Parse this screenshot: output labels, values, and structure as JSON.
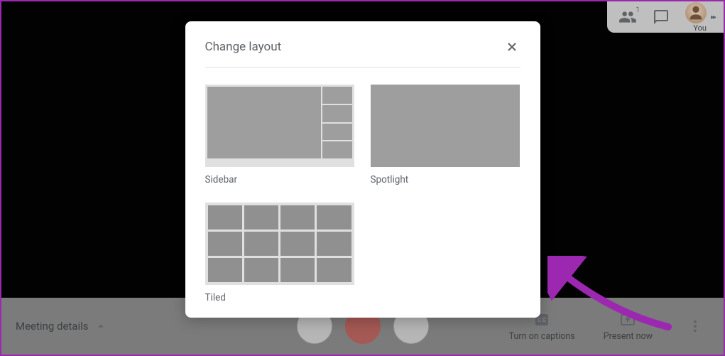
{
  "topbar": {
    "people_badge": "1",
    "profile_label": "You"
  },
  "dialog": {
    "title": "Change layout",
    "options": [
      {
        "label": "Sidebar"
      },
      {
        "label": "Spotlight"
      },
      {
        "label": "Tiled"
      }
    ]
  },
  "controls": {
    "meeting_details": "Meeting details",
    "captions": "Turn on captions",
    "present": "Present now"
  }
}
